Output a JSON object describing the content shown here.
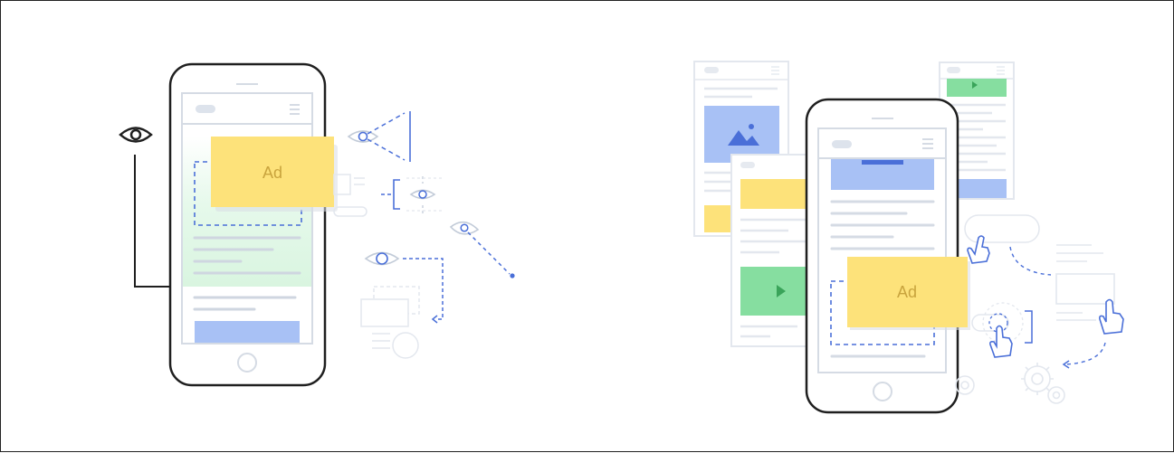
{
  "colors": {
    "outline": "#1f1f1f",
    "light_line": "#e3e7ee",
    "ui_line": "#d5dbe4",
    "accent_blue": "#4a6fd8",
    "blue_fill": "#a8c1f5",
    "yellow_ad": "#fde27a",
    "green_fill": "#86dea0",
    "green_fade": "#e4f8e9",
    "ad_text": "#c9a43e"
  },
  "left_panel": {
    "ad_label": "Ad",
    "icons": [
      "eye-icon",
      "hamburger-menu-icon",
      "home-button-icon"
    ]
  },
  "right_panel": {
    "ad_label": "Ad",
    "icons": [
      "image-icon",
      "play-icon",
      "hand-pointer-icon",
      "gear-icon"
    ]
  }
}
